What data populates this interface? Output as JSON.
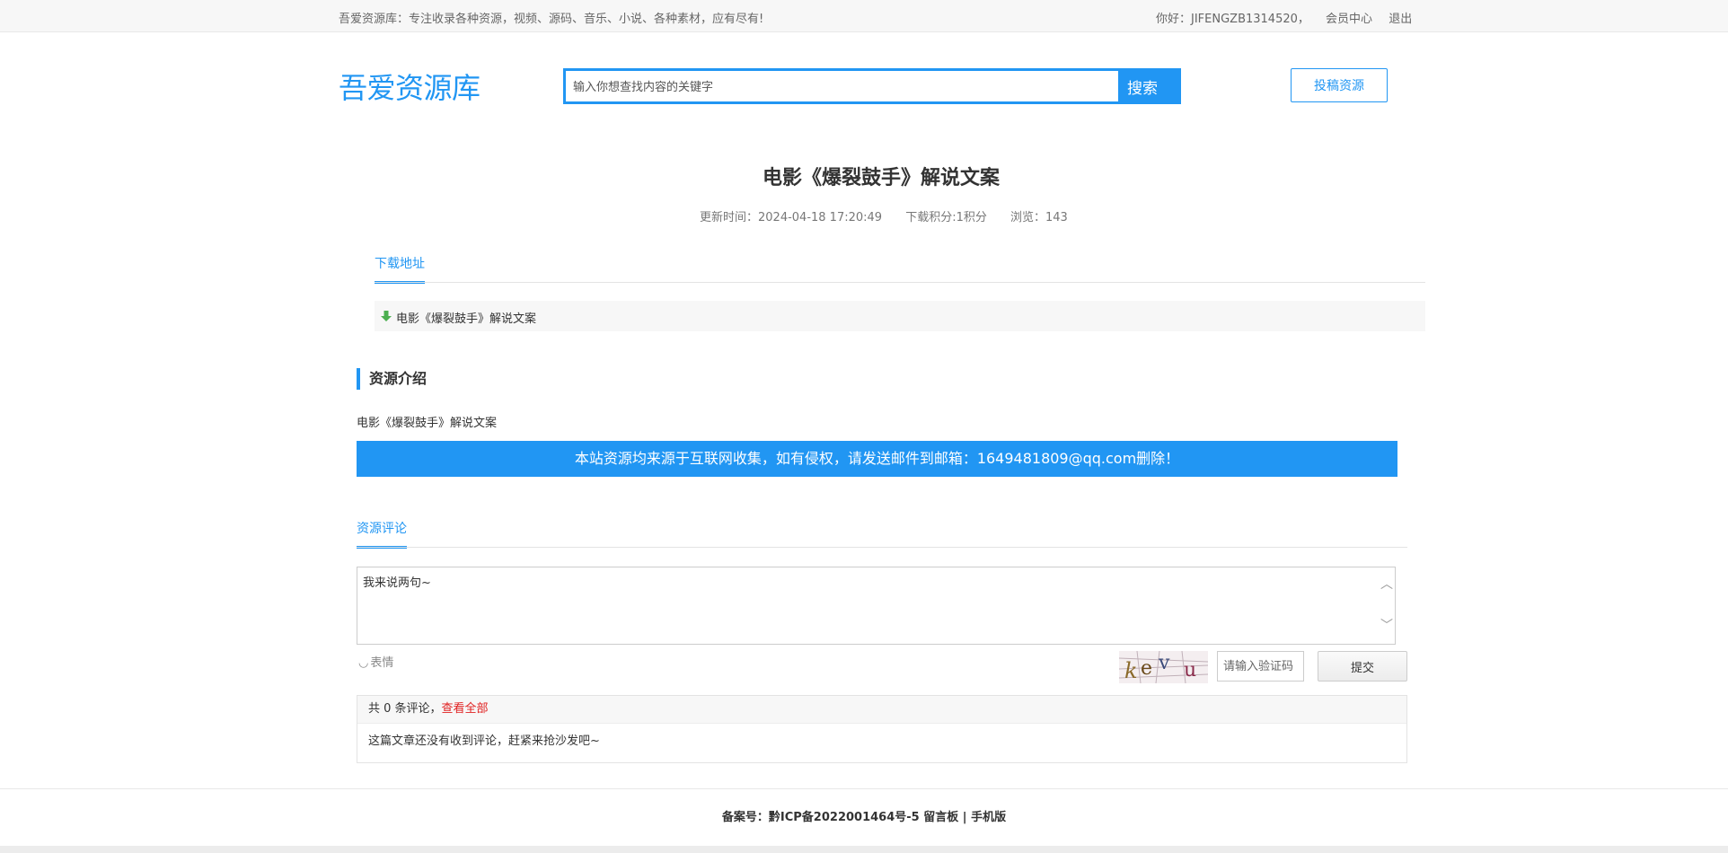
{
  "topbar": {
    "slogan": "吾爱资源库：专注收录各种资源，视频、源码、音乐、小说、各种素材，应有尽有!",
    "greeting": "你好：JIFENGZB1314520，",
    "member_center": "会员中心",
    "logout": "退出"
  },
  "header": {
    "logo": "吾爱资源库",
    "search_placeholder": "输入你想查找内容的关键字",
    "search_button": "搜索",
    "contribute_button": "投稿资源"
  },
  "article": {
    "title": "电影《爆裂鼓手》解说文案",
    "updated": "更新时间：2024-04-18 17:20:49",
    "points": "下载积分:1积分",
    "views": "浏览：143"
  },
  "download": {
    "tab_label": "下载地址",
    "item_label": "电影《爆裂鼓手》解说文案"
  },
  "intro": {
    "heading": "资源介绍",
    "text": "电影《爆裂鼓手》解说文案",
    "notice": "本站资源均来源于互联网收集，如有侵权，请发送邮件到邮箱：1649481809@qq.com删除！"
  },
  "comments": {
    "tab_label": "资源评论",
    "textarea_value": "我来说两句~",
    "emoji_label": "表情",
    "captcha_placeholder": "请输入验证码",
    "submit_label": "提交",
    "count_text": "共 0 条评论，",
    "view_all": "查看全部",
    "empty_text": "这篇文章还没有收到评论，赶紧来抢沙发吧~"
  },
  "footer": {
    "icp": "备案号：黔ICP备2022001464号-5",
    "guestbook": "留言板",
    "separator": "|",
    "mobile": "手机版"
  },
  "colors": {
    "accent": "#2196f3",
    "link_red": "#e02020"
  }
}
